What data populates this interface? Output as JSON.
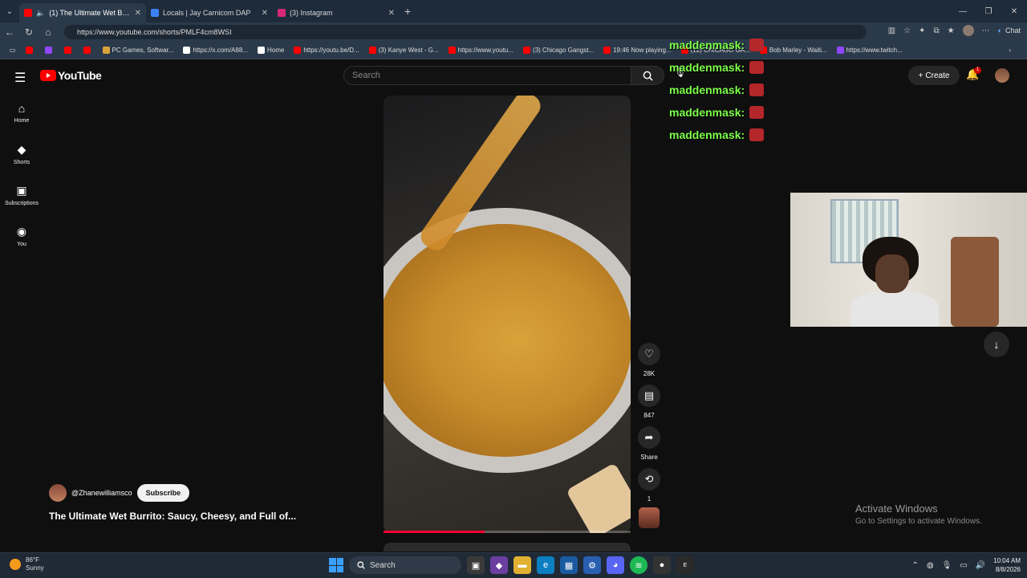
{
  "browser": {
    "tabs": [
      {
        "title": "(1) The Ultimate Wet Burrito: S",
        "favicon_color": "#ff0000",
        "active": true
      },
      {
        "title": "Locals | Jay Carnicom DAP",
        "favicon_color": "#3b82f6",
        "active": false
      },
      {
        "title": "(3) Instagram",
        "favicon_color": "#d62976",
        "active": false
      }
    ],
    "url": "https://www.youtube.com/shorts/PMLF4cm8WSI",
    "chat_label": "Chat",
    "bookmarks": [
      {
        "label": "",
        "icon_color": "#ff0000"
      },
      {
        "label": "",
        "icon_color": "#9146ff"
      },
      {
        "label": "",
        "icon_color": "#ff0000"
      },
      {
        "label": "",
        "icon_color": "#ff0000"
      },
      {
        "label": "PC Games, Softwar...",
        "icon_color": "#d9a23a"
      },
      {
        "label": "https://x.com/A88...",
        "icon_color": "#ffffff"
      },
      {
        "label": "Home",
        "icon_color": "#ffffff"
      },
      {
        "label": "https://youtu.be/D...",
        "icon_color": "#ff0000"
      },
      {
        "label": "(3) Kanye West - G...",
        "icon_color": "#ff0000"
      },
      {
        "label": "https://www.youtu...",
        "icon_color": "#ff0000"
      },
      {
        "label": "(3) Chicago Gangst...",
        "icon_color": "#ff0000"
      },
      {
        "label": "19:46 Now playing...",
        "icon_color": "#ff0000"
      },
      {
        "label": "(12) CHICAGO GA...",
        "icon_color": "#ff0000"
      },
      {
        "label": "Bob Marley - Waiti...",
        "icon_color": "#ff0000"
      },
      {
        "label": "https://www.twitch...",
        "icon_color": "#9146ff"
      }
    ]
  },
  "youtube": {
    "logo_text": "YouTube",
    "search_placeholder": "Search",
    "create_label": "Create",
    "notification_count": "1",
    "sidebar": [
      {
        "label": "Home",
        "icon": "⌂"
      },
      {
        "label": "Shorts",
        "icon": "◆"
      },
      {
        "label": "Subscriptions",
        "icon": "▣"
      },
      {
        "label": "You",
        "icon": "◉"
      }
    ],
    "video": {
      "channel": "@Zhanewilliamsco",
      "subscribe_label": "Subscribe",
      "title": "The Ultimate Wet Burrito: Saucy, Cheesy, and Full of...",
      "progress": 0.41
    },
    "actions": {
      "likes": "28K",
      "comments": "847",
      "share": "Share",
      "remix": "1"
    }
  },
  "stream_overlay": {
    "chat_lines": [
      "maddenmask:",
      "maddenmask:",
      "maddenmask:",
      "maddenmask:",
      "maddenmask:"
    ]
  },
  "watermark": {
    "line1": "Activate Windows",
    "line2": "Go to Settings to activate Windows."
  },
  "taskbar": {
    "weather_temp": "86°F",
    "weather_desc": "Sunny",
    "search_label": "Search",
    "time": "10:04 AM",
    "date": "8/8/2026"
  }
}
